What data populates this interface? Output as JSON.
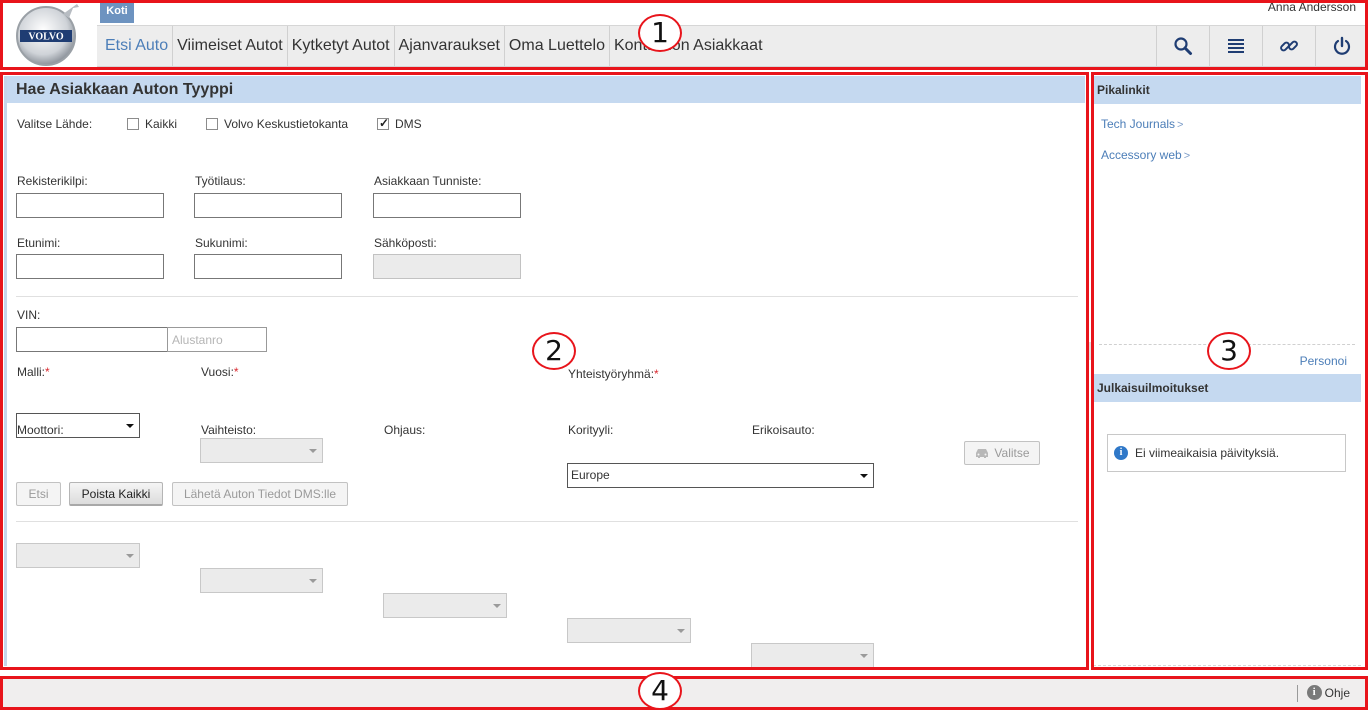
{
  "header": {
    "home_tab": "Koti",
    "user_name": "Anna Andersson",
    "logo_text": "VOLVO",
    "nav_items": [
      {
        "label": "Etsi Auto",
        "active": true
      },
      {
        "label": "Viimeiset Autot",
        "active": false
      },
      {
        "label": "Kytketyt Autot",
        "active": false
      },
      {
        "label": "Ajanvaraukset",
        "active": false
      },
      {
        "label": "Oma Luettelo",
        "active": false
      },
      {
        "label": "Kontaktion Asiakkaat",
        "active": false
      }
    ],
    "nav_icons": [
      "search-icon",
      "list-icon",
      "link-icon",
      "power-icon"
    ]
  },
  "main": {
    "title": "Hae Asiakkaan Auton Tyyppi",
    "source": {
      "label": "Valitse Lähde:",
      "options": [
        {
          "label": "Kaikki",
          "checked": false
        },
        {
          "label": "Volvo Keskustietokanta",
          "checked": false
        },
        {
          "label": "DMS",
          "checked": true
        }
      ]
    },
    "fields": {
      "registration": {
        "label": "Rekisterikilpi:",
        "value": ""
      },
      "work_order": {
        "label": "Työtilaus:",
        "value": ""
      },
      "customer_id": {
        "label": "Asiakkaan Tunniste:",
        "value": ""
      },
      "first_name": {
        "label": "Etunimi:",
        "value": ""
      },
      "last_name": {
        "label": "Sukunimi:",
        "value": ""
      },
      "email": {
        "label": "Sähköposti:",
        "value": ""
      },
      "vin": {
        "label": "VIN:",
        "value": "",
        "chassis_placeholder": "Alustanro"
      }
    },
    "selects": {
      "model": {
        "label": "Malli:",
        "required_mark": "*",
        "value": ""
      },
      "year": {
        "label": "Vuosi:",
        "required_mark": "*",
        "value": ""
      },
      "partner_group": {
        "label": "Yhteistyöryhmä:",
        "required_mark": "*",
        "value": "Europe"
      },
      "engine": {
        "label": "Moottori:",
        "value": ""
      },
      "gearbox": {
        "label": "Vaihteisto:",
        "value": ""
      },
      "steering": {
        "label": "Ohjaus:",
        "value": ""
      },
      "body_style": {
        "label": "Korityyli:",
        "value": ""
      },
      "special_car": {
        "label": "Erikoisauto:",
        "value": ""
      }
    },
    "buttons": {
      "select": "Valitse",
      "search": "Etsi",
      "clear_all": "Poista Kaikki",
      "send_dms": "Lähetä Auton Tiedot DMS:lle"
    }
  },
  "side": {
    "quick_links_title": "Pikalinkit",
    "quick_links": [
      {
        "label": "Tech Journals",
        "arrow": ">"
      },
      {
        "label": "Accessory web",
        "arrow": ">"
      }
    ],
    "personalize": "Personoi",
    "release_notes_title": "Julkaisuilmoitukset",
    "release_notes_empty": "Ei viimeaikaisia päivityksiä."
  },
  "footer": {
    "help": "Ohje"
  },
  "annotations": [
    "1",
    "2",
    "3",
    "4"
  ],
  "colors": {
    "accent": "#4c7eb8",
    "panel_header": "#c5d9f0",
    "annotation_red": "#e8141b"
  }
}
